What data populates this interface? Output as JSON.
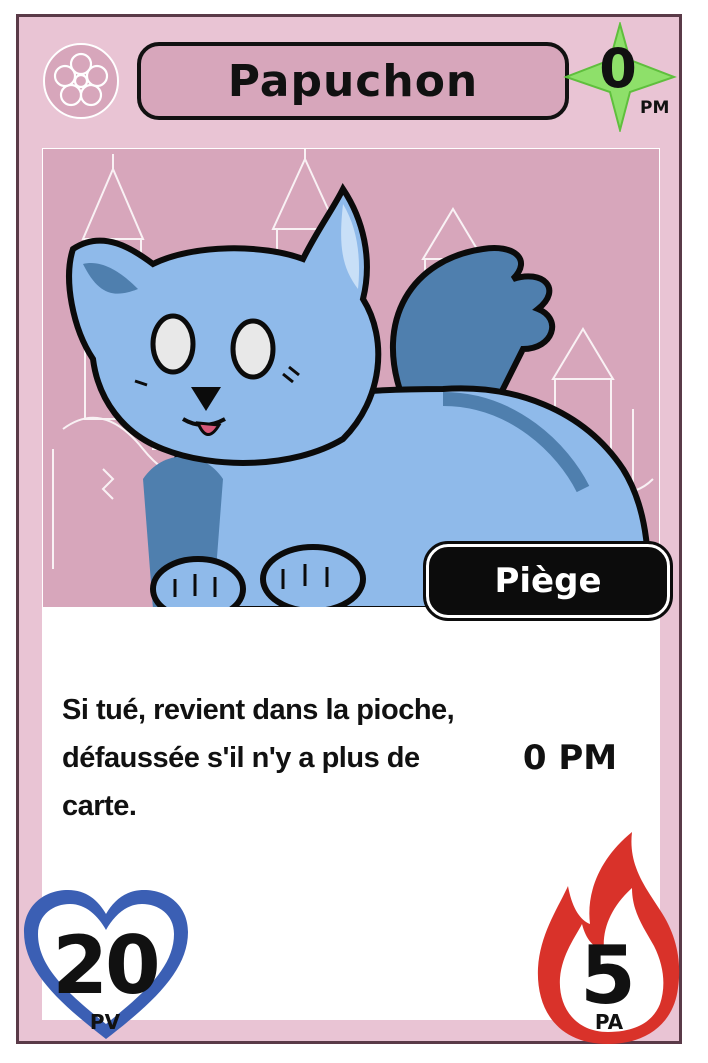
{
  "card": {
    "name": "Papuchon",
    "mana_value": "0",
    "mana_unit": "PM",
    "type": "Piège",
    "ability_text": "Si tué, revient dans la pioche, défaussée s'il n'y a plus de carte.",
    "cost": "0 PM",
    "hp_value": "20",
    "hp_unit": "PV",
    "attack_value": "5",
    "attack_unit": "PA"
  },
  "icons": {
    "top_left": "flower-icon",
    "mana": "star-icon",
    "hp": "heart-icon",
    "attack": "flame-icon"
  },
  "colors": {
    "card_bg": "#e9c4d4",
    "title_bg": "#d7a6bb",
    "star_green": "#8ee06a",
    "heart_blue": "#3b5fb4",
    "flame_red": "#d9322a",
    "creature_blue": "#8fbaea"
  }
}
